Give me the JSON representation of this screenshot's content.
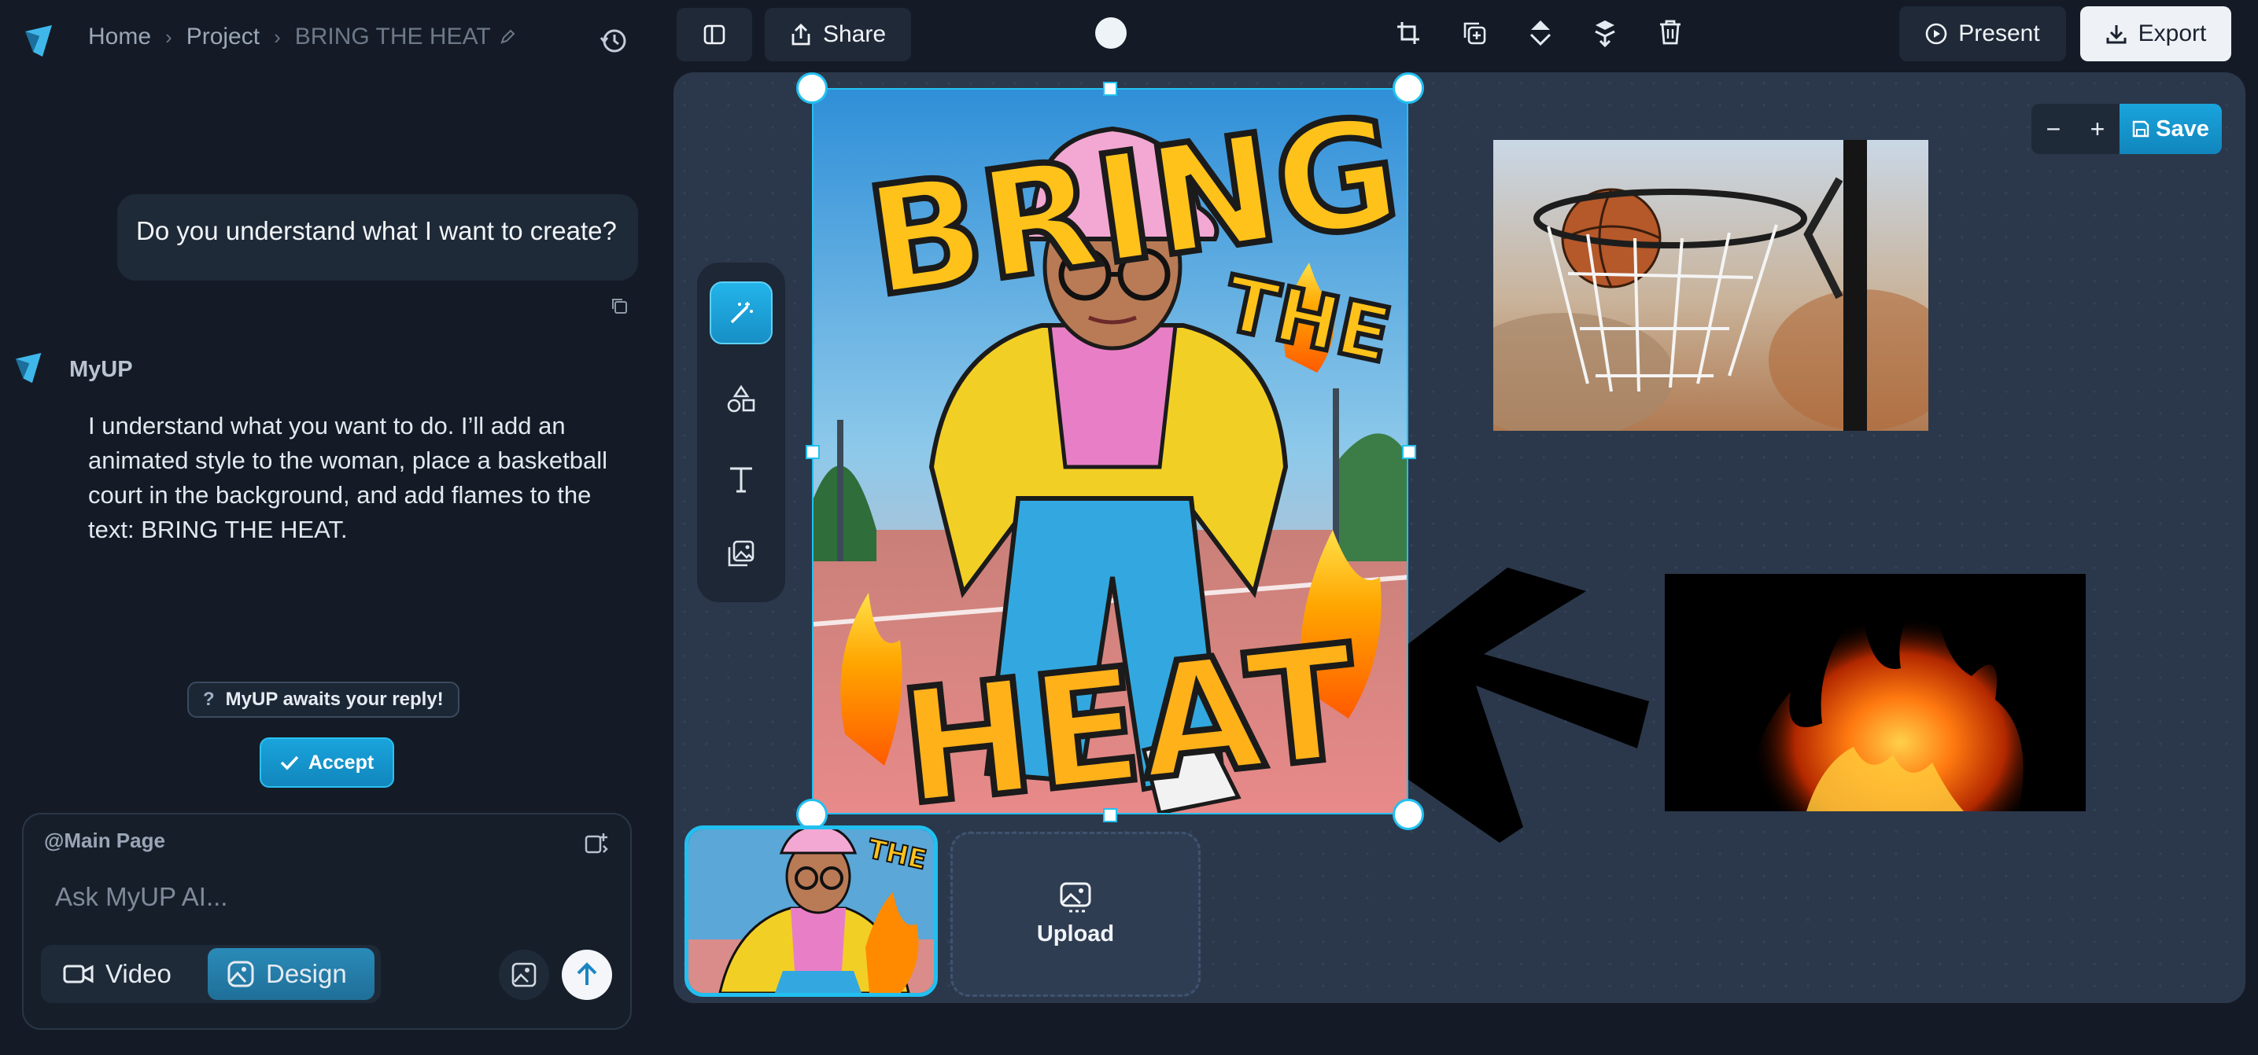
{
  "breadcrumb": {
    "home": "Home",
    "project": "Project",
    "current": "BRING THE HEAT"
  },
  "chat": {
    "user_message": "Do you understand what I want to create?",
    "bot_name": "MyUP",
    "bot_message": "I understand what you want to do. I’ll add an animated style to the woman, place a basketball court in the background, and add flames to the text: BRING THE HEAT.",
    "await_text": "MyUP awaits your reply!",
    "await_icon": "?",
    "accept_label": "Accept"
  },
  "composer": {
    "context": "@Main Page",
    "placeholder": "Ask MyUP AI...",
    "video_tab": "Video",
    "design_tab": "Design",
    "active_tab": "Design"
  },
  "toolbar": {
    "share": "Share",
    "present": "Present",
    "export": "Export"
  },
  "canvas": {
    "zoom_minus": "−",
    "zoom_plus": "+",
    "save": "Save",
    "poster_text": {
      "line1": "BRING",
      "line2": "THE",
      "line3": "HEAT"
    },
    "upload": "Upload"
  },
  "colors": {
    "accent": "#1aa4dc",
    "selection": "#22c0f0",
    "background": "#141b26",
    "canvas": "#2b384b"
  }
}
